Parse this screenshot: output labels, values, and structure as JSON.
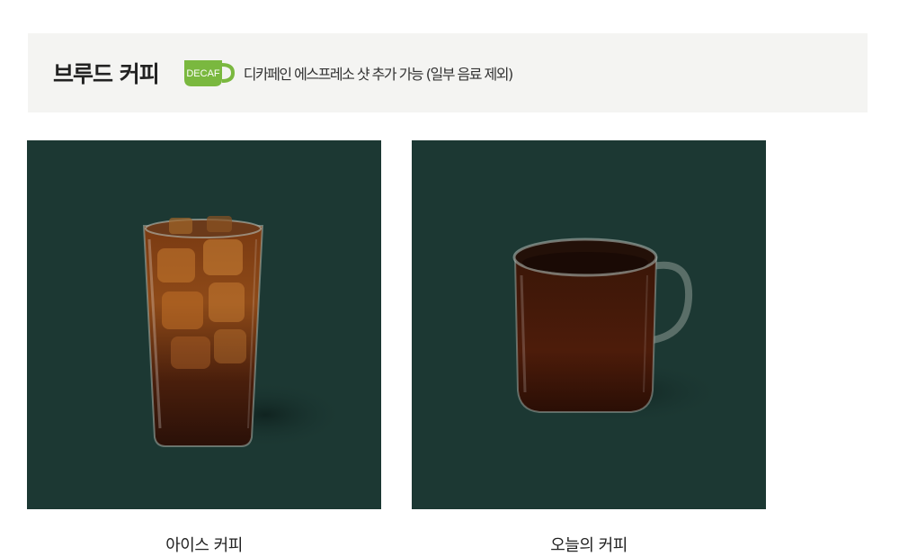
{
  "category": {
    "title": "브루드 커피",
    "decaf_badge_text": "DECAF",
    "decaf_note": "디카페인 에스프레소 샷 추가 가능 (일부 음료 제외)"
  },
  "products": [
    {
      "name": "아이스 커피",
      "image": "iced-coffee-glass"
    },
    {
      "name": "오늘의 커피",
      "image": "hot-coffee-mug"
    }
  ],
  "colors": {
    "image_background": "#1c3833",
    "badge_green": "#7ab83f",
    "bar_background": "#f4f4f2"
  }
}
